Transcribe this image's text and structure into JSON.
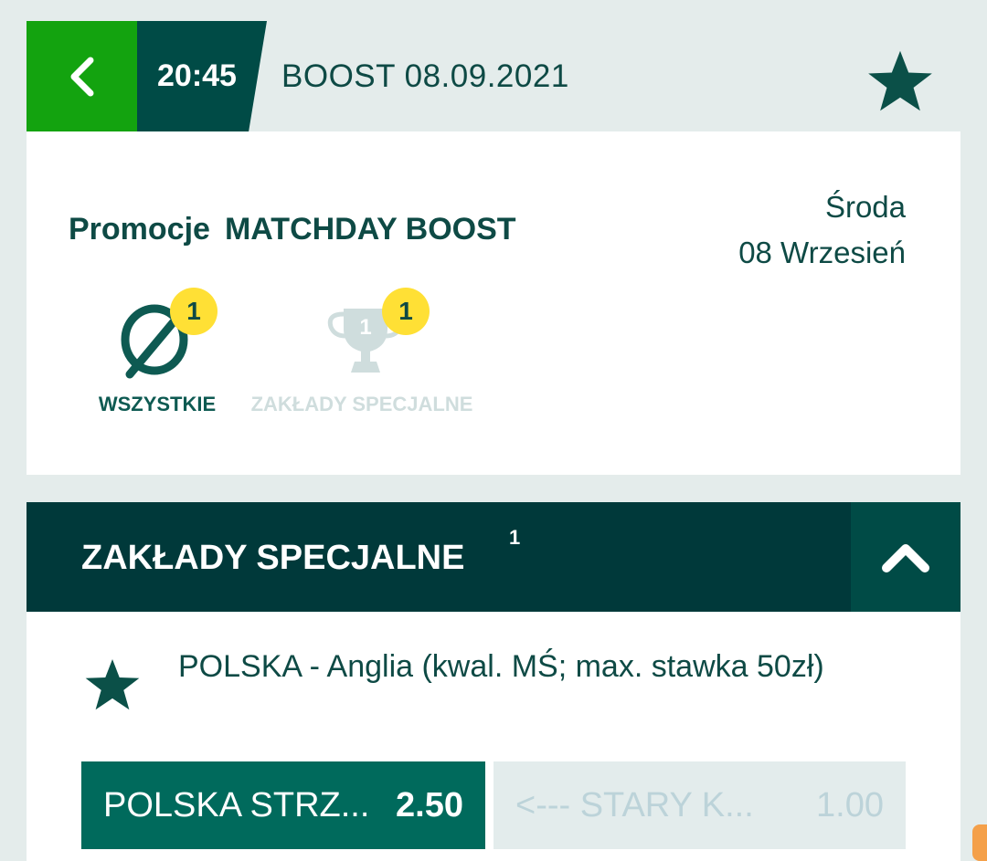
{
  "header": {
    "time": "20:45",
    "title": "BOOST 08.09.2021"
  },
  "event": {
    "category": "Promocje",
    "name": "MATCHDAY BOOST",
    "day": "Środa",
    "date": "08 Wrzesień"
  },
  "filters": [
    {
      "label": "WSZYSTKIE",
      "count": "1",
      "active": true,
      "icon": "all-markets-icon"
    },
    {
      "label": "ZAKŁADY SPECJALNE",
      "count": "1",
      "active": false,
      "icon": "trophy-icon",
      "icon_text": "1"
    }
  ],
  "section": {
    "title": "ZAKŁADY SPECJALNE",
    "count": "1"
  },
  "market": {
    "title": "POLSKA - Anglia (kwal. MŚ; max. stawka 50zł)",
    "odds": [
      {
        "label": "POLSKA STRZ...",
        "value": "2.50",
        "state": "active"
      },
      {
        "label": "<--- STARY K...",
        "value": "1.00",
        "state": "disabled"
      }
    ]
  },
  "colors": {
    "accent_green": "#13a30f",
    "dark_teal": "#004b46",
    "section_bg": "#00393a",
    "badge_yellow": "#ffe035",
    "odd_active": "#006a5c",
    "odd_disabled": "#e3ecec"
  }
}
